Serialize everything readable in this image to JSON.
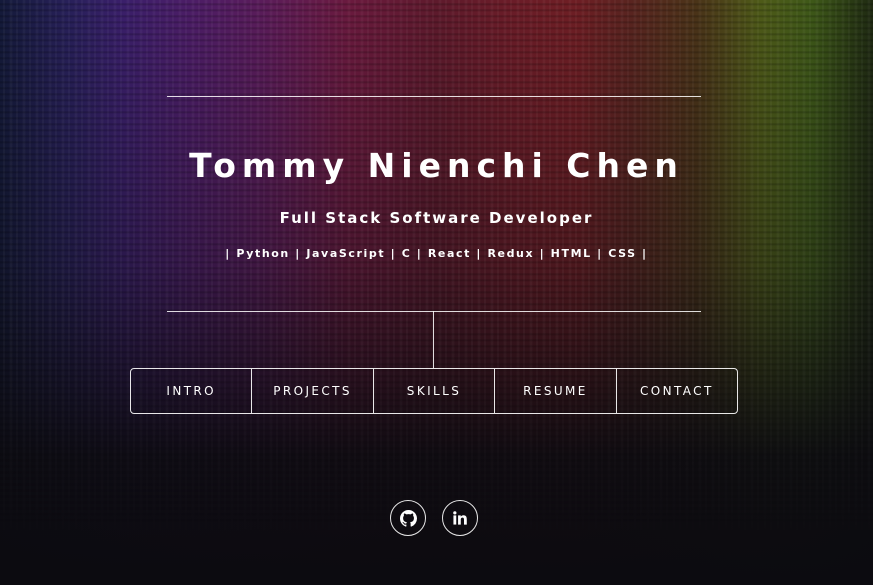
{
  "header": {
    "name": "Tommy Nienchi Chen",
    "role": "Full Stack Software Developer",
    "skills": "| Python | JavaScript | C | React | Redux | HTML | CSS |"
  },
  "nav": {
    "items": [
      {
        "label": "INTRO"
      },
      {
        "label": "PROJECTS"
      },
      {
        "label": "SKILLS"
      },
      {
        "label": "RESUME"
      },
      {
        "label": "CONTACT"
      }
    ]
  },
  "socials": {
    "github_icon": "github-icon",
    "linkedin_icon": "linkedin-icon"
  },
  "colors": {
    "background": "#0c0b10",
    "text": "#ffffff",
    "border": "#ffffff"
  }
}
